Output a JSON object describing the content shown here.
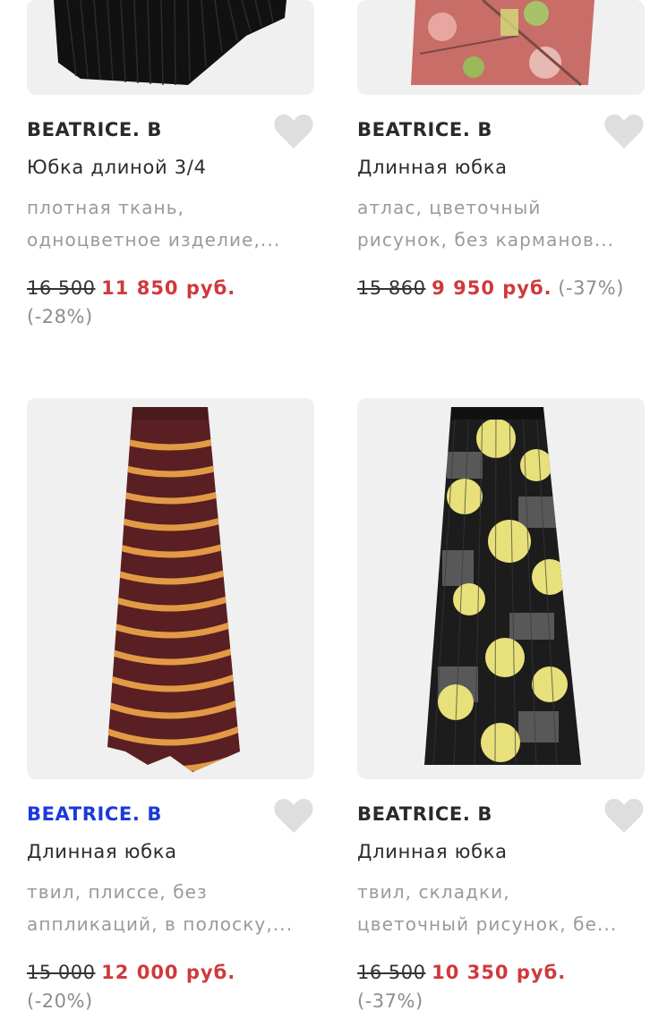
{
  "colors": {
    "accent_price": "#d0393c",
    "brand_link": "#1a3ad8",
    "heart": "#dedede",
    "card_bg": "#f0f0f0"
  },
  "products": [
    {
      "brand": "BEATRICE. B",
      "title": "Юбка длиной 3/4",
      "desc_lines": [
        "плотная ткань,",
        "одноцветное изделие,..."
      ],
      "old_price": "16 500",
      "new_price": "11 850 руб.",
      "discount": "(-28%)",
      "image": "black-pleated-asymmetric-skirt"
    },
    {
      "brand": "BEATRICE. B",
      "title": "Длинная юбка",
      "desc_lines": [
        "атлас, цветочный",
        "рисунок, без карманов..."
      ],
      "old_price": "15 860",
      "new_price": "9 950 руб.",
      "discount": "(-37%)",
      "image": "pink-floral-pleated-skirt"
    },
    {
      "brand": "BEATRICE. B",
      "title": "Длинная юбка",
      "desc_lines": [
        "твил, плиссе, без",
        "аппликаций, в полоску,..."
      ],
      "old_price": "15 000",
      "new_price": "12 000 руб.",
      "discount": "(-20%)",
      "image": "striped-pleated-maxi-skirt"
    },
    {
      "brand": "BEATRICE. B",
      "title": "Длинная юбка",
      "desc_lines": [
        "твил, складки,",
        "цветочный рисунок, бе..."
      ],
      "old_price": "16 500",
      "new_price": "10 350 руб.",
      "discount": "(-37%)",
      "image": "black-yellow-floral-pleated-skirt"
    }
  ]
}
